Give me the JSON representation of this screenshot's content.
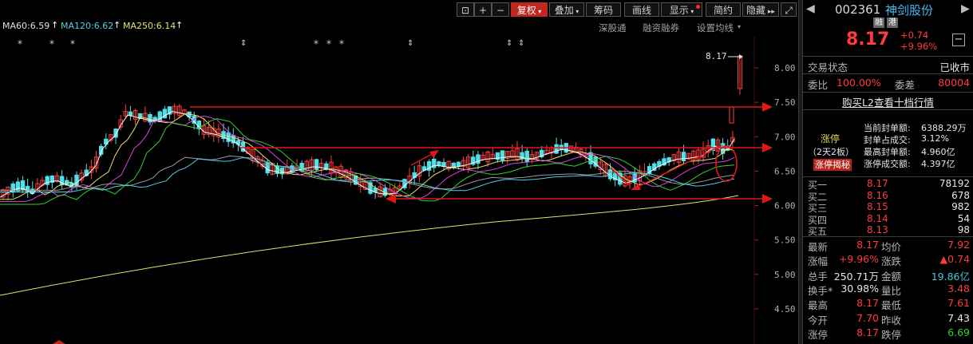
{
  "toolbar": {
    "buttons": [
      "复权",
      "叠加",
      "筹码",
      "画线",
      "显示",
      "简约",
      "隐藏"
    ],
    "fuquan_label": "复权",
    "overlay_label": "叠加",
    "chips_label": "筹码",
    "draw_label": "画线",
    "display_label": "显示",
    "simple_label": "简约",
    "hide_label": "隐藏"
  },
  "ma_legend": {
    "ma60": "MA60:6.59",
    "ma120": "MA120:6.62",
    "ma250": "MA250:6.14",
    "colors": {
      "ma60": "#e0e0e0",
      "ma120": "#4fd0e0",
      "ma250": "#e8e070",
      "arrow": "#ffffff"
    }
  },
  "sub_tabs": {
    "shengutong": "深股通",
    "margin": "融资融券",
    "ma_settings": "设置均线"
  },
  "price_axis": {
    "ticks": [
      "8.00",
      "7.50",
      "7.00",
      "6.50",
      "6.00",
      "5.50",
      "5.00",
      "4.50"
    ]
  },
  "last_price_label": "8.17",
  "stock": {
    "code": "002361",
    "name": "神剑股份",
    "tag_margin": "融",
    "tag_hk": "港",
    "price": "8.17",
    "change": "+0.74",
    "change_pct": "+9.96%"
  },
  "trade_status": {
    "label": "交易状态",
    "value": "已收市"
  },
  "commission": {
    "ratio_label": "委比",
    "ratio_value": "100.00%",
    "diff_label": "委差",
    "diff_value": "80004"
  },
  "l2_link": "购买L2查看十档行情",
  "limit_up": {
    "title": "涨停",
    "days": "（2天2板）",
    "reveal": "涨停揭秘",
    "items": [
      {
        "label": "当前封单额:",
        "value": "6388.29万"
      },
      {
        "label": "封单占成交:",
        "value": "3.12%"
      },
      {
        "label": "最高封单额:",
        "value": "4.960亿"
      },
      {
        "label": "涨停成交额:",
        "value": "4.397亿"
      }
    ]
  },
  "bids": [
    {
      "label": "买一",
      "price": "8.17",
      "vol": "78192"
    },
    {
      "label": "买二",
      "price": "8.16",
      "vol": "678"
    },
    {
      "label": "买三",
      "price": "8.15",
      "vol": "982"
    },
    {
      "label": "买四",
      "price": "8.14",
      "vol": "54"
    },
    {
      "label": "买五",
      "price": "8.13",
      "vol": "98"
    }
  ],
  "stats": [
    {
      "l1": "最新",
      "v1": "8.17",
      "c1": "red",
      "l2": "均价",
      "v2": "7.92",
      "c2": "red"
    },
    {
      "l1": "涨幅",
      "v1": "+9.96%",
      "c1": "red",
      "l2": "涨跌",
      "v2": "▲0.74",
      "c2": "red"
    },
    {
      "l1": "总手",
      "v1": "250.71万",
      "c1": "wht",
      "l2": "金额",
      "v2": "19.86亿",
      "c2": "cyn"
    },
    {
      "l1": "换手*",
      "v1": "30.98%",
      "c1": "wht",
      "l2": "量比",
      "v2": "3.48",
      "c2": "red"
    },
    {
      "l1": "最高",
      "v1": "8.17",
      "c1": "red",
      "l2": "最低",
      "v2": "7.61",
      "c2": "red"
    },
    {
      "l1": "今开",
      "v1": "7.70",
      "c1": "red",
      "l2": "昨收",
      "v2": "7.43",
      "c2": "wht"
    },
    {
      "l1": "涨停",
      "v1": "8.17",
      "c1": "red",
      "l2": "跌停",
      "v2": "6.69",
      "c2": "grn"
    }
  ]
}
